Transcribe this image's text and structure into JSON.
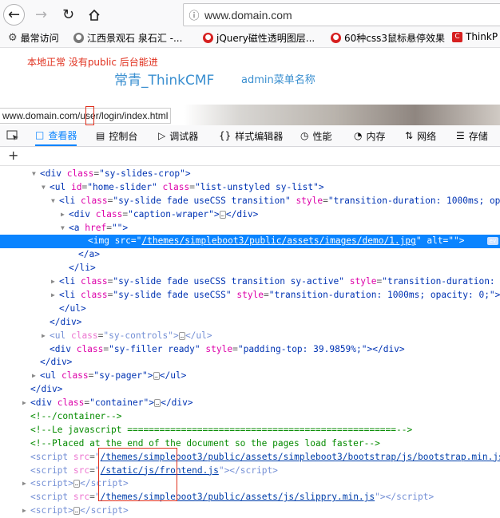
{
  "browser": {
    "url": "www.domain.com",
    "bookmarks": [
      "最常访问",
      "江西景观石 泉石汇 -...",
      "jQuery磁性透明图层...",
      "60种css3鼠标悬停效果",
      "ThinkP"
    ]
  },
  "page": {
    "notice": "本地正常 没有public 后台能进",
    "brand": "常青_ThinkCMF",
    "admin_menu": "admin菜单名称",
    "status_url": "www.domain.com/user/login/index.html"
  },
  "devtools": {
    "tabs": [
      "查看器",
      "控制台",
      "调试器",
      "样式编辑器",
      "性能",
      "内存",
      "网络",
      "存储"
    ],
    "active_tab": "查看器",
    "add_button": "+",
    "event_badge": "ev"
  },
  "colors": {
    "accent": "#0a84ff",
    "tag": "#0033b3",
    "attr": "#dd00a9",
    "comment": "#058b00",
    "highlight_box": "#e0301e"
  }
}
